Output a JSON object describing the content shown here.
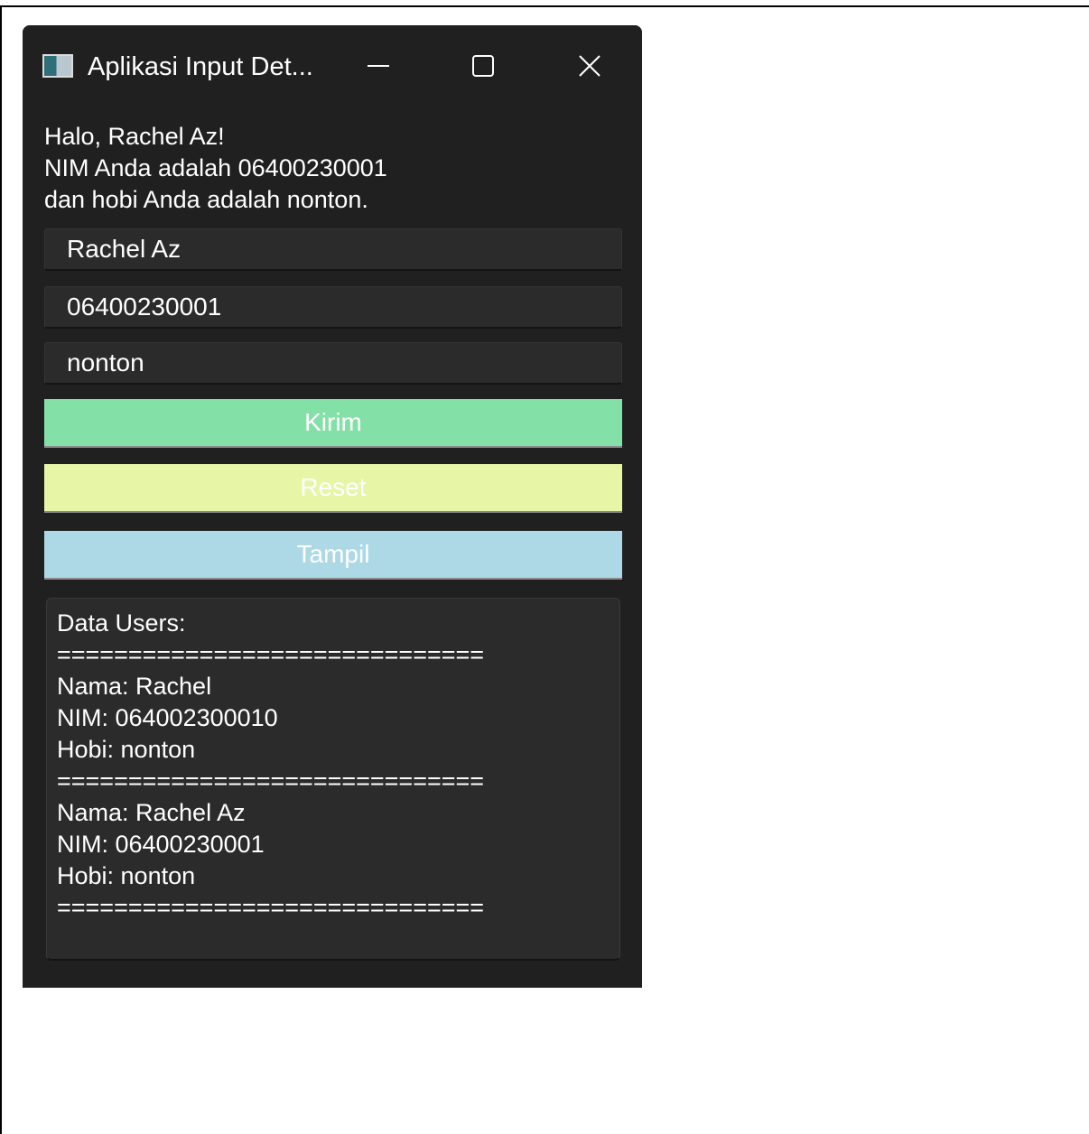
{
  "window": {
    "title": "Aplikasi Input Det...",
    "icons": {
      "app": "app-window-icon",
      "minimize": "minimize-icon",
      "maximize": "maximize-icon",
      "close": "close-icon"
    }
  },
  "greeting": {
    "line1": "Halo, Rachel Az!",
    "line2": "NIM Anda adalah 06400230001",
    "line3": "dan hobi Anda adalah nonton."
  },
  "form": {
    "nama_value": "Rachel Az",
    "nim_value": "06400230001",
    "hobi_value": "nonton"
  },
  "buttons": {
    "kirim": "Kirim",
    "reset": "Reset",
    "tampil": "Tampil"
  },
  "output": {
    "header": "Data Users:",
    "separator": "==============================",
    "records": [
      {
        "nama": "Nama: Rachel",
        "nim": "NIM: 064002300010",
        "hobi": "Hobi: nonton"
      },
      {
        "nama": "Nama: Rachel Az",
        "nim": "NIM: 06400230001",
        "hobi": "Hobi: nonton"
      }
    ]
  },
  "colors": {
    "window_bg": "#202020",
    "field_bg": "#2b2b2b",
    "kirim": "#83e1a8",
    "reset": "#e7f5a7",
    "tampil": "#add8e6"
  }
}
